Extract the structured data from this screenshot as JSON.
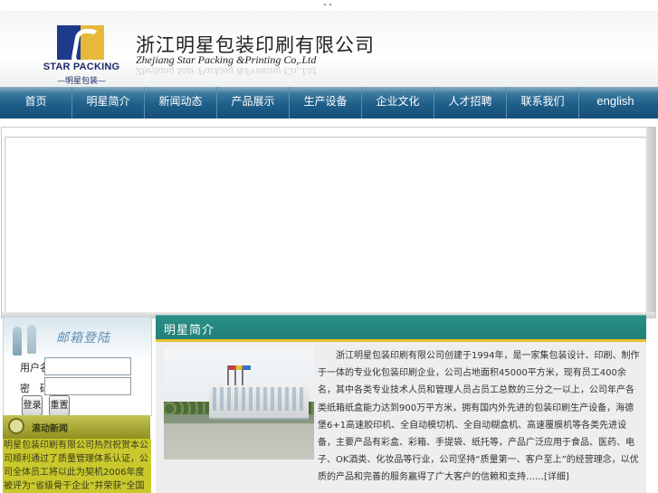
{
  "top_marks": "\" \"",
  "header": {
    "logo_name": "STAR PACKING",
    "logo_cn": "—明星包装—",
    "company_cn": "浙江明星包装印刷有限公司",
    "company_en": "Zhejiang Star Packing &Printing Co,.Ltd"
  },
  "nav": {
    "items": [
      {
        "label": "首页"
      },
      {
        "label": "明星简介"
      },
      {
        "label": "新闻动态"
      },
      {
        "label": "产品展示"
      },
      {
        "label": "生产设备"
      },
      {
        "label": "企业文化"
      },
      {
        "label": "人才招聘"
      },
      {
        "label": "联系我们"
      },
      {
        "label": "english"
      }
    ]
  },
  "mail_login": {
    "title": "邮箱登陆",
    "username_label": "用户名：",
    "password_label": "密　码：",
    "username_value": "",
    "password_value": "",
    "login_button": "登录",
    "reset_button": "重置"
  },
  "news": {
    "title": "滚动新闻",
    "text": "明星包装印刷有限公司热烈祝贺本公司顺利通过了质量管理体系认证，公司全体员工将以此为契机2006年度被评为“省级骨干企业”并荣获“全国印刷百强”“浙江省诚信企业”等荣誉称号明星包装印刷有限公司欢迎您"
  },
  "intro": {
    "title": "明星简介",
    "text": "浙江明星包装印刷有限公司创建于1994年，是一家集包装设计、印刷、制作于一体的专业化包装印刷企业，公司占地面积45000平方米，现有员工400余名，其中各类专业技术人员和管理人员占员工总数的三分之一以上，公司年产各类纸箱纸盒能力达到900万平方米，拥有国内外先进的包装印刷生产设备，海德堡6+1高速胶印机、全自动模切机、全自动糊盒机、高速覆膜机等各类先进设备，主要产品有彩盒、彩箱、手提袋、纸托等，产品广泛应用于食品、医药、电子、OK酒类、化妆品等行业，公司坚持“质量第一、客户至上”的经营理念，以优质的产品和完善的服务赢得了广大客户的信赖和支持……",
    "more": "[详细]"
  },
  "colors": {
    "nav_bg": "#1e5f8a",
    "intro_head": "#1f7f77",
    "intro_bar": "#e7c22b",
    "news_bg": "#c9c92e"
  }
}
